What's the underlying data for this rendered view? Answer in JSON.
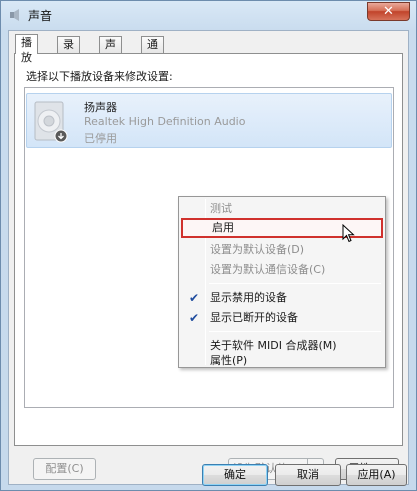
{
  "window": {
    "title": "声音",
    "close_label": "✕"
  },
  "tabs": [
    {
      "label": "播放",
      "active": true
    },
    {
      "label": "录制",
      "active": false
    },
    {
      "label": "声音",
      "active": false
    },
    {
      "label": "通信",
      "active": false
    }
  ],
  "panel": {
    "instruction": "选择以下播放设备来修改设置:"
  },
  "device": {
    "name": "扬声器",
    "description": "Realtek High Definition Audio",
    "status": "已停用"
  },
  "context_menu": {
    "items": [
      {
        "label": "测试",
        "enabled": false,
        "checked": false
      },
      {
        "label": "启用",
        "enabled": true,
        "checked": false,
        "highlighted": true
      },
      {
        "label": "设置为默认设备(D)",
        "enabled": false,
        "checked": false
      },
      {
        "label": "设置为默认通信设备(C)",
        "enabled": false,
        "checked": false
      },
      {
        "label": "显示禁用的设备",
        "enabled": true,
        "checked": true
      },
      {
        "label": "显示已断开的设备",
        "enabled": true,
        "checked": true
      },
      {
        "label": "关于软件 MIDI 合成器(M)",
        "enabled": true,
        "checked": false
      },
      {
        "label": "属性(P)",
        "enabled": true,
        "checked": false
      }
    ],
    "check_glyph": "✔"
  },
  "buttons": {
    "configure": "配置(C)",
    "set_default": "设为默认值(S)",
    "properties": "属性(P)",
    "ok": "确定",
    "cancel": "取消",
    "apply": "应用(A)"
  }
}
